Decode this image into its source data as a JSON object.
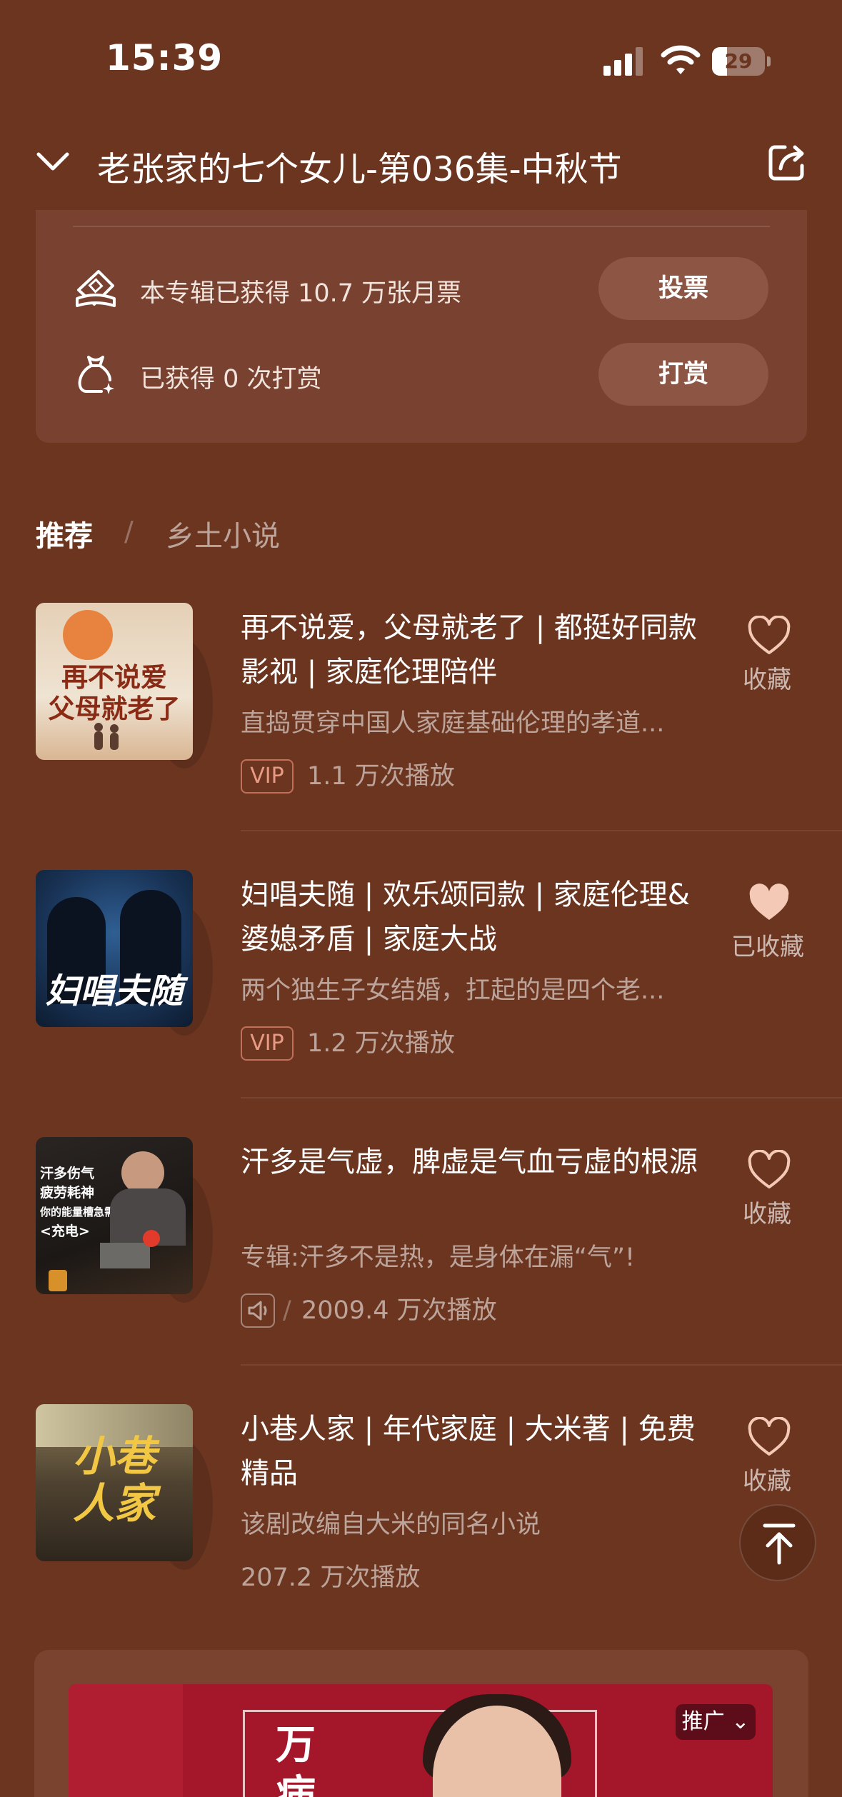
{
  "status_bar": {
    "time": "15:39",
    "battery_level": "29",
    "battery_fraction": 0.29
  },
  "header": {
    "title": "老张家的七个女儿-第036集-中秋节",
    "back_icon": "chevron-down-icon",
    "share_icon": "share-icon"
  },
  "support": {
    "ticket_text": "本专辑已获得 10.7 万张月票",
    "vote_label": "投票",
    "reward_text": "已获得 0 次打赏",
    "reward_label": "打赏"
  },
  "tabs": {
    "active": "推荐",
    "separator": "/",
    "inactive": "乡土小说"
  },
  "items": [
    {
      "cover_text": "再不说爱\n父母就老了",
      "title": "再不说爱，父母就老了 | 都挺好同款影视 | 家庭伦理陪伴",
      "desc": "直捣贯穿中国人家庭基础伦理的孝道...",
      "badge": "VIP",
      "plays": "1.1 万次播放",
      "fav_label": "收藏",
      "favorited": false
    },
    {
      "cover_text": "妇唱夫随",
      "title": "妇唱夫随 | 欢乐颂同款 | 家庭伦理&婆媳矛盾 | 家庭大战",
      "desc": "两个独生子女结婚，扛起的是四个老...",
      "badge": "VIP",
      "plays": "1.2 万次播放",
      "fav_label": "已收藏",
      "favorited": true
    },
    {
      "cover_lines": [
        "汗多伤气",
        "疲劳耗神",
        "你的能量槽急需",
        "<充电>"
      ],
      "title": "汗多是气虚，脾虚是气血亏虚的根源",
      "desc": "专辑:汗多不是热，是身体在漏“气”!",
      "badge": "",
      "plays": "2009.4 万次播放",
      "fav_label": "收藏",
      "favorited": false
    },
    {
      "cover_text": "小巷\n人家",
      "title": "小巷人家 | 年代家庭 | 大米著 | 免费精品",
      "desc": "该剧改编自大米的同名小说",
      "badge": "",
      "plays": "207.2 万次播放",
      "fav_label": "收藏",
      "favorited": false
    }
  ],
  "ad": {
    "badge": "推广 ⌄",
    "text_1": "万",
    "text_2": "病"
  },
  "colors": {
    "background": "#6b3520",
    "card": "#784130",
    "pill": "#8c5544",
    "vip": "#e89b84",
    "fav_active": "#f4c9b6"
  }
}
